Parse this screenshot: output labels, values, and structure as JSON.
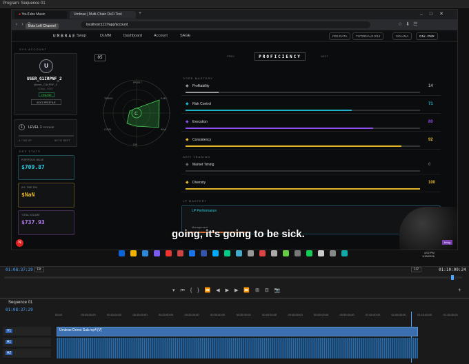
{
  "premiere": {
    "window_title": "Program: Sequence 01",
    "current_time": "01:08:37:29",
    "fit": "Fit",
    "fraction": "1/2",
    "duration": "01:10:09:24"
  },
  "browser": {
    "tabs": [
      {
        "label": "YouTube Music"
      },
      {
        "label": "Umbrae | Multi-Chain DeFi Tool"
      }
    ],
    "url": "localhost:1117/app/account",
    "tooltip": "Bots Left Channel"
  },
  "app": {
    "logo": "UMBRAE",
    "nav": [
      "Swap",
      "DLMM",
      "Dashboard",
      "Account",
      "SAGE"
    ],
    "fee_pill": "FEE DATA",
    "tutorials_pill": "TUTORIALS 0/14",
    "balance_pill": "SOLANA",
    "wallet": "G1ir...PMX",
    "profile": {
      "section": "SYS.ACCOUNT",
      "avatar": "U",
      "username": "USER_G1IRPNF_2",
      "handle": "@user_G1irPNF_2",
      "id": "G1irp...XOX",
      "status": "ONLINE",
      "edit": "EDIT PROFILE",
      "level": "LEVEL 1",
      "level_tag": "ROOKIE",
      "xp": "0 / 100 XP",
      "next": "99 TO NEXT"
    },
    "stats": {
      "section": "DEX STATS",
      "portfolio_label": "PORTFOLIO VALUE",
      "portfolio_value": "$709.87",
      "alltime_label": "ALL-TIME PNL",
      "alltime_value": "$NaN",
      "volume_label": "TOTAL VOLUME",
      "volume_value": "$737.93"
    },
    "rank": "05",
    "proficiency": "PROFICIENCY",
    "prev": "PREV",
    "next": "NEXT",
    "radar": {
      "center": "C",
      "labels": [
        "PROFIT",
        "EXEC",
        "RISK",
        "DIV",
        "CONS",
        "TIMING"
      ]
    },
    "core_mastery": "CORE MASTERY",
    "bars": [
      {
        "label": "Profitability",
        "value": "14",
        "pct": 0.14,
        "color": "#9a9a9a"
      },
      {
        "label": "Risk Control",
        "value": "71",
        "pct": 0.71,
        "color": "#1fb5c9"
      },
      {
        "label": "Execution",
        "value": "80",
        "pct": 0.8,
        "color": "#8c4cf0"
      },
      {
        "label": "Consistency",
        "value": "92",
        "pct": 0.92,
        "color": "#e3b62a"
      }
    ],
    "defi_trading": "DEFI TRADING",
    "bars2": [
      {
        "label": "Market Timing",
        "value": "0",
        "pct": 0.0,
        "color": "#666"
      },
      {
        "label": "Diversity",
        "value": "100",
        "pct": 1.0,
        "color": "#e3b62a"
      }
    ],
    "lp_mastery": "LP MASTERY",
    "lp_label": "LP Performance",
    "lp_sub": "Management"
  },
  "caption": "going, it's going to be sick.",
  "webcam_badge": "bring",
  "taskbar": {
    "time": "4:02 PM",
    "date": "1/15/2026"
  },
  "timeline": {
    "sequence": "Sequence 01",
    "timecode": "01:08:37:29",
    "ruler": [
      "00:00",
      "00:05:00:00",
      "00:10:00:00",
      "00:15:00:00",
      "00:20:00:00",
      "00:25:00:00",
      "00:30:00:00",
      "00:35:00:00",
      "00:40:00:00",
      "00:45:00:00",
      "00:50:00:00",
      "00:55:00:00",
      "01:00:00:00",
      "01:05:00:00",
      "01:10:00:00",
      "01:15:00:00"
    ],
    "clip": "Umbrae Demo Sub.mp4 [V]",
    "tracks": [
      "V1",
      "A1",
      "A2"
    ]
  }
}
